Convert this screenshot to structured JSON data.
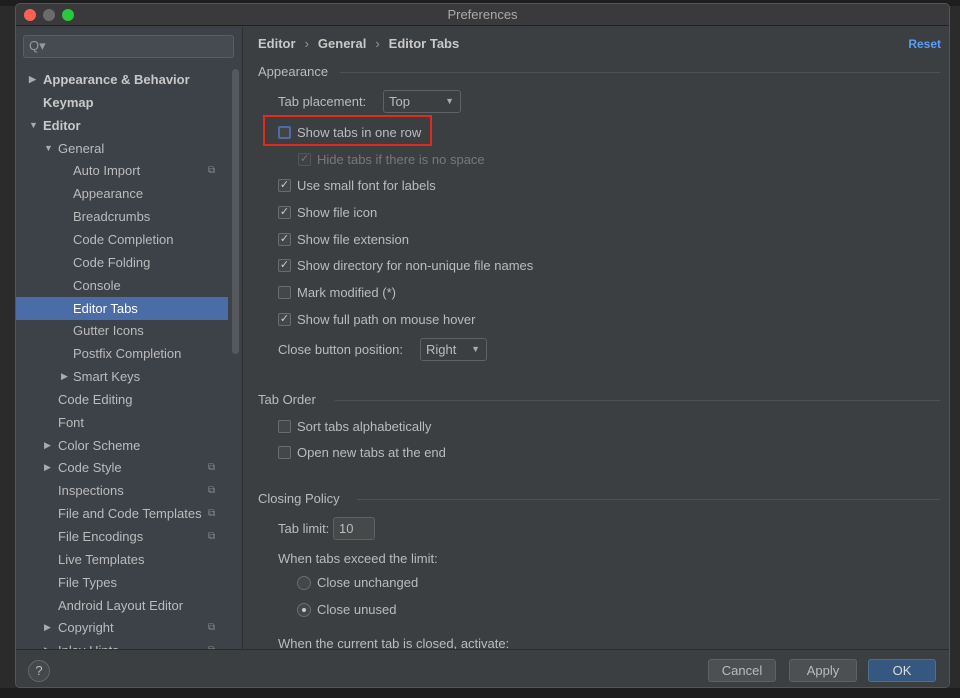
{
  "window": {
    "title": "Preferences"
  },
  "search": {
    "placeholder": "Q▾"
  },
  "sidebar": {
    "items": [
      {
        "label": "Appearance & Behavior",
        "level": 0,
        "arrow": "right",
        "bold": true
      },
      {
        "label": "Keymap",
        "level": 0,
        "bold": true
      },
      {
        "label": "Editor",
        "level": 0,
        "arrow": "down",
        "bold": true
      },
      {
        "label": "General",
        "level": 1,
        "arrow": "down"
      },
      {
        "label": "Auto Import",
        "level": 2,
        "copy": true
      },
      {
        "label": "Appearance",
        "level": 2
      },
      {
        "label": "Breadcrumbs",
        "level": 2
      },
      {
        "label": "Code Completion",
        "level": 2
      },
      {
        "label": "Code Folding",
        "level": 2
      },
      {
        "label": "Console",
        "level": 2
      },
      {
        "label": "Editor Tabs",
        "level": 2,
        "selected": true
      },
      {
        "label": "Gutter Icons",
        "level": 2
      },
      {
        "label": "Postfix Completion",
        "level": 2
      },
      {
        "label": "Smart Keys",
        "level": 2,
        "arrow": "right"
      },
      {
        "label": "Code Editing",
        "level": 1
      },
      {
        "label": "Font",
        "level": 1
      },
      {
        "label": "Color Scheme",
        "level": 1,
        "arrow": "right"
      },
      {
        "label": "Code Style",
        "level": 1,
        "arrow": "right",
        "copy": true
      },
      {
        "label": "Inspections",
        "level": 1,
        "copy": true
      },
      {
        "label": "File and Code Templates",
        "level": 1,
        "copy": true
      },
      {
        "label": "File Encodings",
        "level": 1,
        "copy": true
      },
      {
        "label": "Live Templates",
        "level": 1
      },
      {
        "label": "File Types",
        "level": 1
      },
      {
        "label": "Android Layout Editor",
        "level": 1
      },
      {
        "label": "Copyright",
        "level": 1,
        "arrow": "right",
        "copy": true
      },
      {
        "label": "Inlay Hints",
        "level": 1,
        "arrow": "right",
        "copy": true
      }
    ]
  },
  "breadcrumb": [
    "Editor",
    "General",
    "Editor Tabs"
  ],
  "reset_label": "Reset",
  "appearance": {
    "title": "Appearance",
    "tab_placement_label": "Tab placement:",
    "tab_placement_value": "Top",
    "show_one_row": {
      "label": "Show tabs in one row",
      "checked": false
    },
    "hide_no_space": {
      "label": "Hide tabs if there is no space",
      "checked": true,
      "disabled": true
    },
    "small_font": {
      "label": "Use small font for labels",
      "checked": true
    },
    "file_icon": {
      "label": "Show file icon",
      "checked": true
    },
    "file_ext": {
      "label": "Show file extension",
      "checked": true
    },
    "dir_nonunique": {
      "label": "Show directory for non-unique file names",
      "checked": true
    },
    "mark_modified": {
      "label": "Mark modified (*)",
      "checked": false
    },
    "full_path": {
      "label": "Show full path on mouse hover",
      "checked": true
    },
    "close_pos_label": "Close button position:",
    "close_pos_value": "Right"
  },
  "tab_order": {
    "title": "Tab Order",
    "sort_alpha": {
      "label": "Sort tabs alphabetically",
      "checked": false
    },
    "open_end": {
      "label": "Open new tabs at the end",
      "checked": false
    }
  },
  "closing": {
    "title": "Closing Policy",
    "tab_limit_label": "Tab limit:",
    "tab_limit_value": "10",
    "exceed_label": "When tabs exceed the limit:",
    "close_unchanged": {
      "label": "Close unchanged",
      "selected": false
    },
    "close_unused": {
      "label": "Close unused",
      "selected": true
    },
    "activate_label": "When the current tab is closed, activate:"
  },
  "footer": {
    "help": "?",
    "cancel": "Cancel",
    "apply": "Apply",
    "ok": "OK"
  }
}
